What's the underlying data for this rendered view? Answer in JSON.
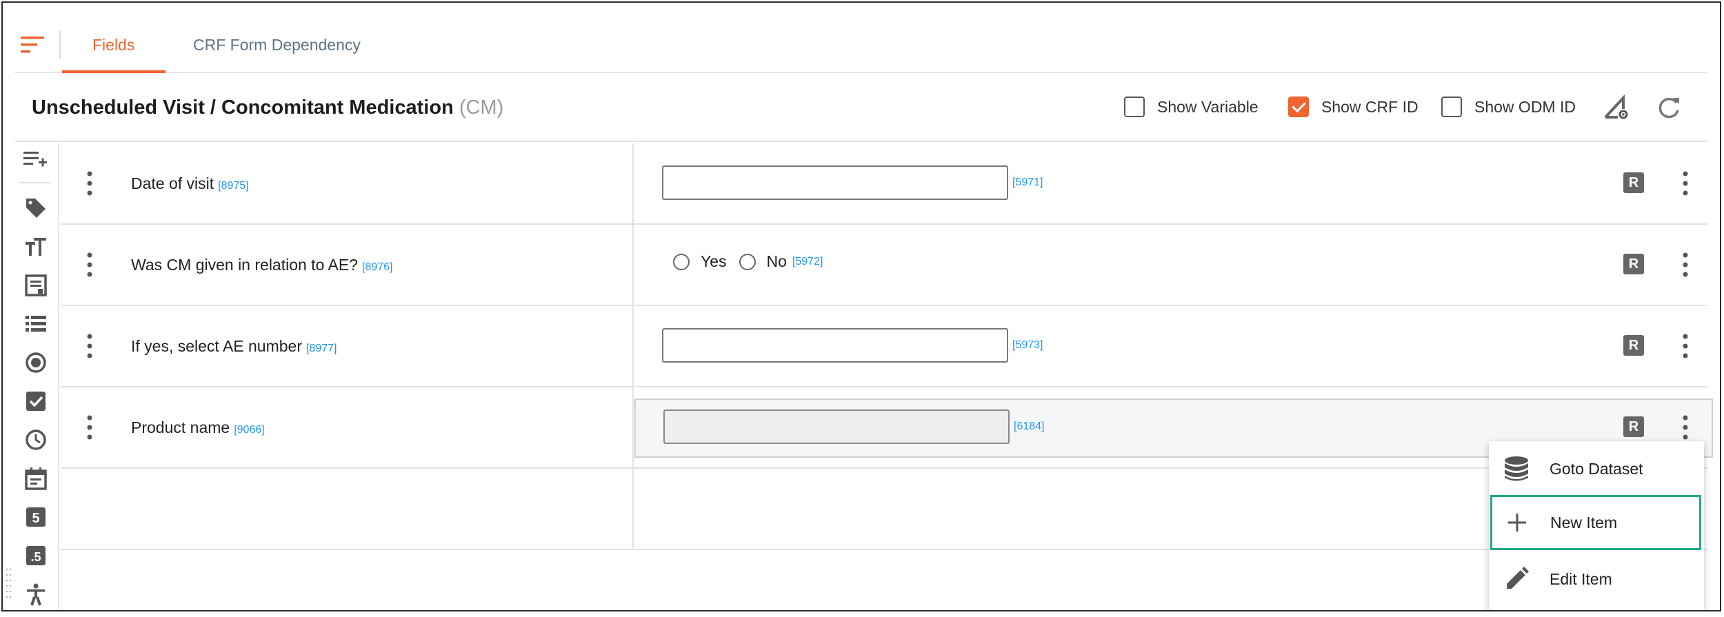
{
  "tabs": [
    {
      "label": "Fields",
      "active": true
    },
    {
      "label": "CRF Form Dependency",
      "active": false
    }
  ],
  "header": {
    "title": "Unscheduled Visit / Concomitant Medication",
    "code": "(CM)",
    "checkboxes": [
      {
        "label": "Show Variable",
        "checked": false
      },
      {
        "label": "Show CRF ID",
        "checked": true
      },
      {
        "label": "Show ODM ID",
        "checked": false
      }
    ]
  },
  "toolbar_icons": [
    "add-row-icon",
    "tag-icon",
    "text-size-icon",
    "note-icon",
    "list-icon",
    "radio-icon",
    "checkbox-icon",
    "clock-icon",
    "calendar-icon",
    "integer-icon",
    "decimal-icon",
    "accessibility-icon"
  ],
  "rows": [
    {
      "label": "Date of visit",
      "id": "[8975]",
      "type": "text",
      "response_id": "[5971]",
      "badge": "R"
    },
    {
      "label": "Was CM given in relation to AE?",
      "id": "[8976]",
      "type": "radio",
      "options": [
        "Yes",
        "No"
      ],
      "response_id": "[5972]",
      "badge": "R"
    },
    {
      "label": "If yes, select AE number",
      "id": "[8977]",
      "type": "text",
      "response_id": "[5973]",
      "badge": "R"
    },
    {
      "label": "Product name",
      "id": "[9066]",
      "type": "text-disabled",
      "response_id": "[6184]",
      "badge": "R"
    }
  ],
  "menu": {
    "items": [
      {
        "label": "Goto Dataset",
        "icon": "database-icon"
      },
      {
        "label": "New Item",
        "icon": "plus-icon",
        "selected": true
      },
      {
        "label": "Edit Item",
        "icon": "pencil-icon"
      }
    ]
  },
  "colors": {
    "accent": "#f06430",
    "link": "#2196f3",
    "tab_inactive": "#5d7384",
    "highlight": "#22a98a"
  }
}
